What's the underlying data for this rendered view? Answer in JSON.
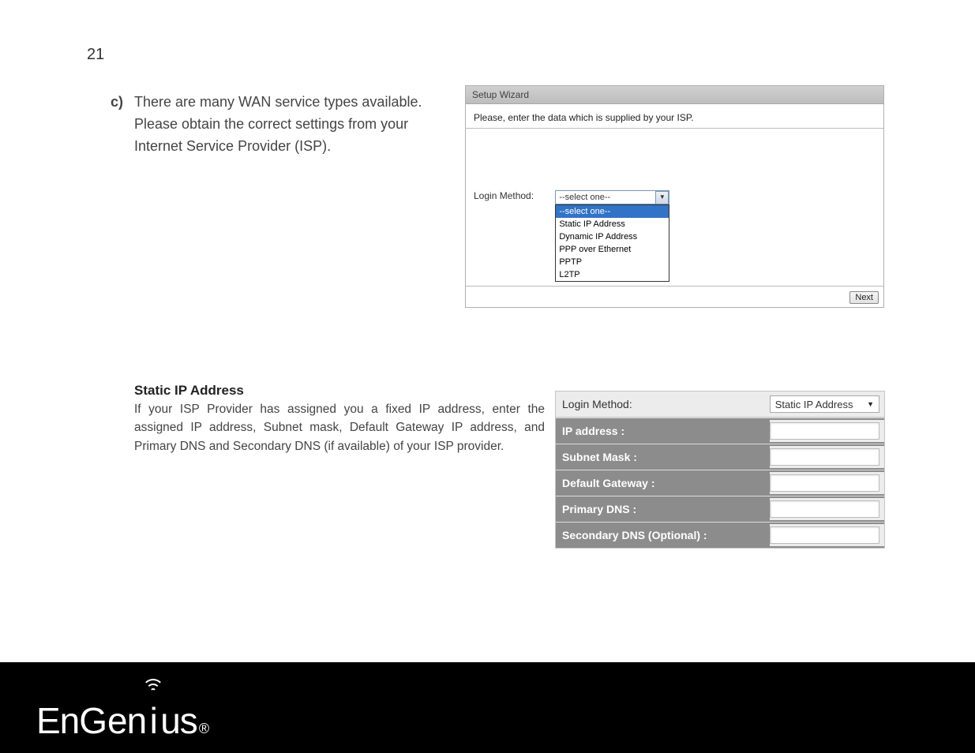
{
  "page_number": "21",
  "section_c": {
    "label": "c)",
    "text": "There are many WAN service types available. Please obtain the correct settings from your Internet Service Provider (ISP)."
  },
  "wizard": {
    "title": "Setup Wizard",
    "instruction": "Please, enter the data which is supplied by your ISP.",
    "login_label": "Login Method:",
    "selected": "--select one--",
    "options": [
      "--select one--",
      "Static IP Address",
      "Dynamic IP Address",
      "PPP over Ethernet",
      "PPTP",
      "L2TP"
    ],
    "next_label": "Next"
  },
  "static": {
    "heading": "Static IP Address",
    "paragraph": "If your ISP Provider has assigned you a fixed IP address, enter the assigned IP address, Subnet mask, Default Gateway IP address, and Primary DNS and Secondary DNS (if available) of your ISP provider."
  },
  "static_table": {
    "login_label": "Login Method:",
    "login_value": "Static IP Address",
    "rows": [
      "IP address :",
      "Subnet Mask :",
      "Default Gateway :",
      "Primary DNS :",
      "Secondary DNS (Optional) :"
    ]
  },
  "logo": {
    "part1": "En",
    "part2": "G",
    "part3": "en",
    "part4": "i",
    "part5": "us",
    "reg": "®"
  }
}
